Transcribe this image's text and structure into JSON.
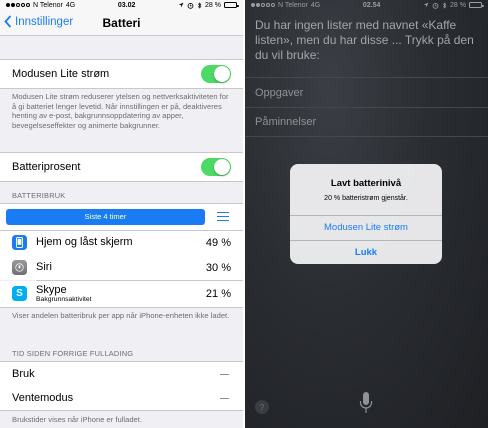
{
  "left": {
    "status_bar": {
      "carrier": "N Telenor",
      "network": "4G",
      "time": "03.02",
      "battery": "28 %",
      "battery_level": 0.28
    },
    "nav": {
      "back_label": "Innstillinger",
      "title": "Batteri"
    },
    "low_power": {
      "label": "Modusen Lite strøm",
      "enabled": true,
      "footnote": "Modusen Lite strøm reduserer ytelsen og nettverksaktiviteten for å gi batteriet lenger levetid. Når innstillingen er på, deaktiveres henting av e-post, bakgrunnsoppdatering av apper, bevegelseseffekter og animerte bakgrunner."
    },
    "battery_percentage": {
      "label": "Batteriprosent",
      "enabled": true
    },
    "usage": {
      "header": "BATTERIBRUK",
      "segment_label": "Siste 4 timer",
      "apps": [
        {
          "name": "Hjem og låst skjerm",
          "subtitle": "",
          "percent": "49 %",
          "icon": "home-lock-screen-icon",
          "color": "#1a7cf5"
        },
        {
          "name": "Siri",
          "subtitle": "",
          "percent": "30 %",
          "icon": "siri-icon",
          "color": "#8e8e93"
        },
        {
          "name": "Skype",
          "subtitle": "Bakgrunnsaktivitet",
          "percent": "21 %",
          "icon": "skype-icon",
          "color": "#00aff0"
        }
      ],
      "footnote": "Viser andelen batteribruk per app når iPhone-enheten ikke ladet."
    },
    "since_charge": {
      "header": "TID SIDEN FORRIGE FULLADING",
      "rows": [
        {
          "label": "Bruk"
        },
        {
          "label": "Ventemodus"
        }
      ],
      "footnote": "Brukstider vises når iPhone er fulladet."
    }
  },
  "right": {
    "status_bar": {
      "carrier": "N Telenor",
      "network": "4G",
      "time": "02.54",
      "battery": "28 %",
      "battery_level": 0.28
    },
    "siri_text": "Du har ingen lister med navnet «Kaffe listen», men du har disse ... Trykk på den du vil bruke:",
    "lists": [
      "Oppgaver",
      "Påminnelser"
    ],
    "alert": {
      "title": "Lavt batterinivå",
      "message": "20 % batteristrøm gjenstår.",
      "primary_button": "Modusen Lite strøm",
      "secondary_button": "Lukk"
    },
    "help_label": "?"
  }
}
